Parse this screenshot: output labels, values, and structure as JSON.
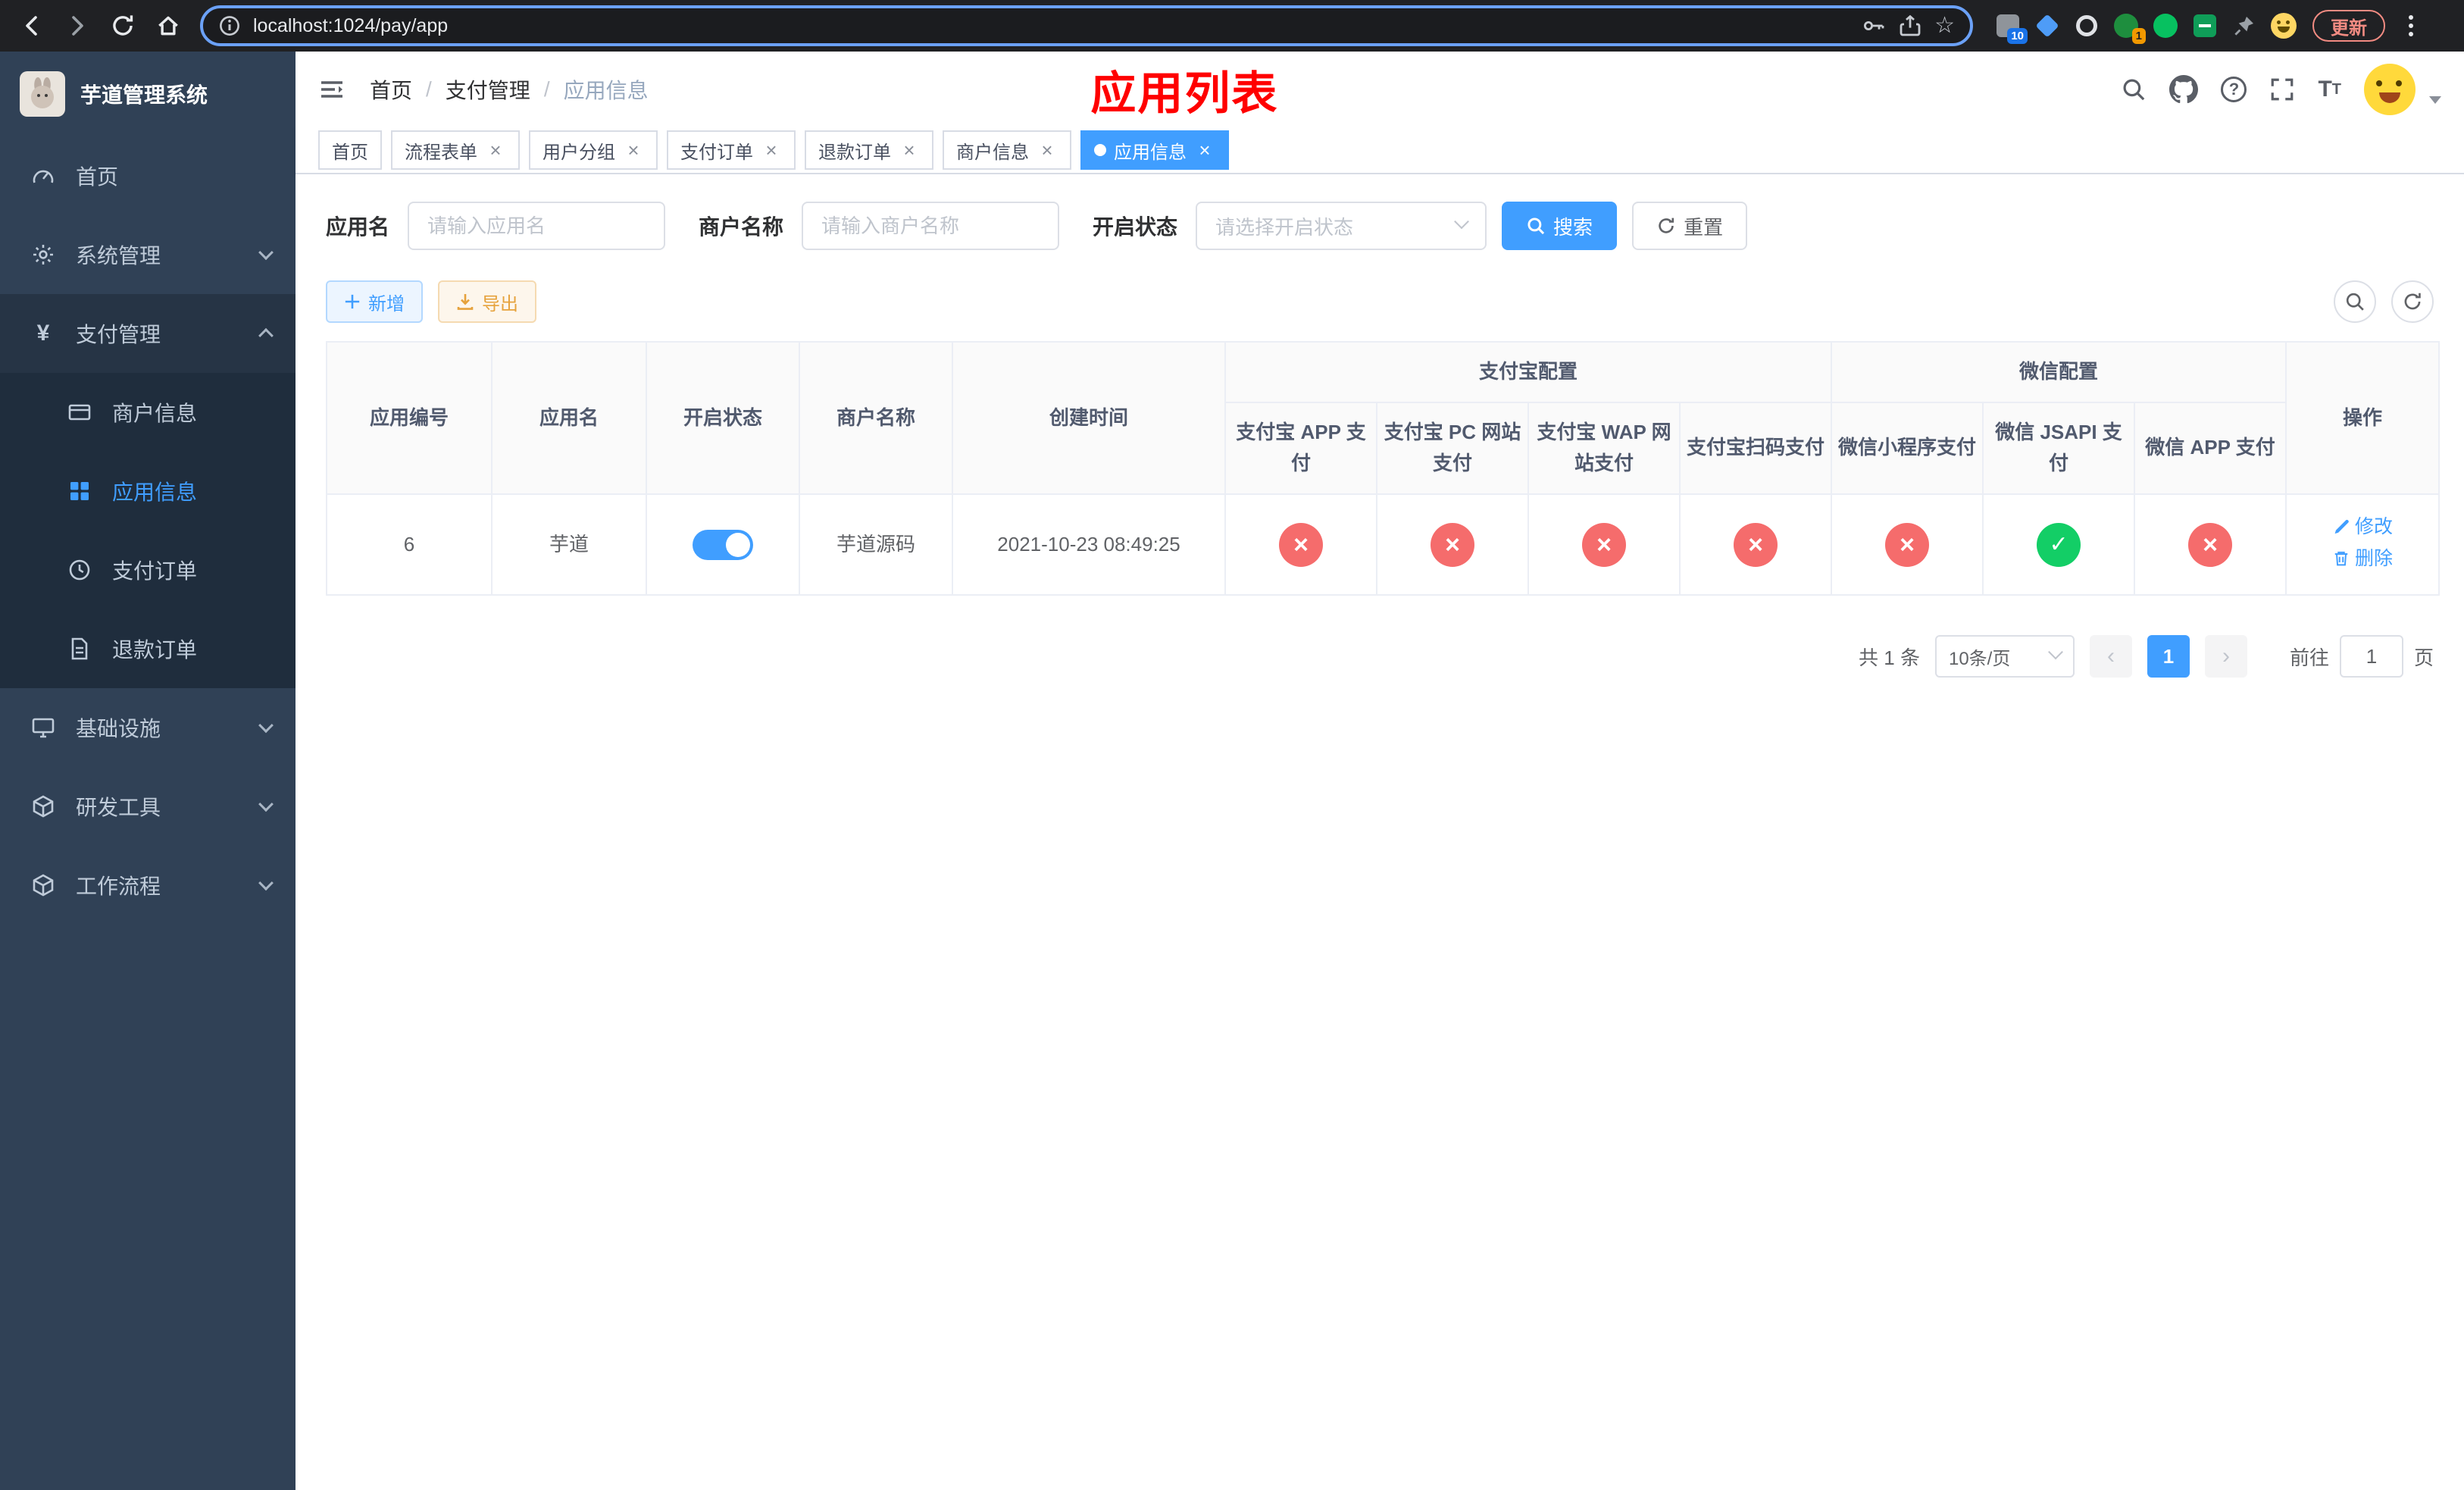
{
  "browser": {
    "url": "localhost:1024/pay/app",
    "update_button": "更新",
    "ext_badge_count": "10",
    "avatar_badge": "1"
  },
  "colors": {
    "accent": "#409eff",
    "danger": "#f56c6c",
    "success": "#13ce66",
    "warning": "#e6a23c",
    "title_red": "#ff0000",
    "sidebar_bg": "#304156",
    "submenu_bg": "#1f2d3d"
  },
  "sidebar": {
    "logo_title": "芋道管理系统",
    "menu": [
      {
        "label": "首页"
      },
      {
        "label": "系统管理"
      },
      {
        "label": "支付管理"
      },
      {
        "label": "基础设施"
      },
      {
        "label": "研发工具"
      },
      {
        "label": "工作流程"
      }
    ],
    "submenu": [
      {
        "label": "商户信息"
      },
      {
        "label": "应用信息"
      },
      {
        "label": "支付订单"
      },
      {
        "label": "退款订单"
      }
    ]
  },
  "header": {
    "breadcrumb": [
      "首页",
      "支付管理",
      "应用信息"
    ],
    "page_title": "应用列表"
  },
  "tabs": [
    {
      "label": "首页"
    },
    {
      "label": "流程表单"
    },
    {
      "label": "用户分组"
    },
    {
      "label": "支付订单"
    },
    {
      "label": "退款订单"
    },
    {
      "label": "商户信息"
    },
    {
      "label": "应用信息"
    }
  ],
  "filters": {
    "app_name_label": "应用名",
    "app_name_placeholder": "请输入应用名",
    "merchant_label": "商户名称",
    "merchant_placeholder": "请输入商户名称",
    "status_label": "开启状态",
    "status_placeholder": "请选择开启状态",
    "search_button": "搜索",
    "reset_button": "重置"
  },
  "toolbar": {
    "add_button": "新增",
    "export_button": "导出"
  },
  "table": {
    "headers": {
      "app_id": "应用编号",
      "app_name": "应用名",
      "status": "开启状态",
      "merchant": "商户名称",
      "created": "创建时间",
      "alipay_group": "支付宝配置",
      "wechat_group": "微信配置",
      "alipay_app": "支付宝 APP 支付",
      "alipay_pc": "支付宝 PC 网站支付",
      "alipay_wap": "支付宝 WAP 网站支付",
      "alipay_qr": "支付宝扫码支付",
      "wx_mini": "微信小程序支付",
      "wx_jsapi": "微信 JSAPI 支付",
      "wx_app": "微信 APP 支付",
      "actions": "操作"
    },
    "rows": [
      {
        "app_id": "6",
        "app_name": "芋道",
        "enabled": true,
        "merchant": "芋道源码",
        "created": "2021-10-23 08:49:25",
        "statuses": [
          "no",
          "no",
          "no",
          "no",
          "no",
          "yes",
          "no"
        ],
        "edit_label": "修改",
        "delete_label": "删除"
      }
    ]
  },
  "pagination": {
    "total_text": "共 1 条",
    "page_size": "10条/页",
    "current_page": "1",
    "goto_prefix": "前往",
    "goto_value": "1",
    "goto_suffix": "页"
  }
}
